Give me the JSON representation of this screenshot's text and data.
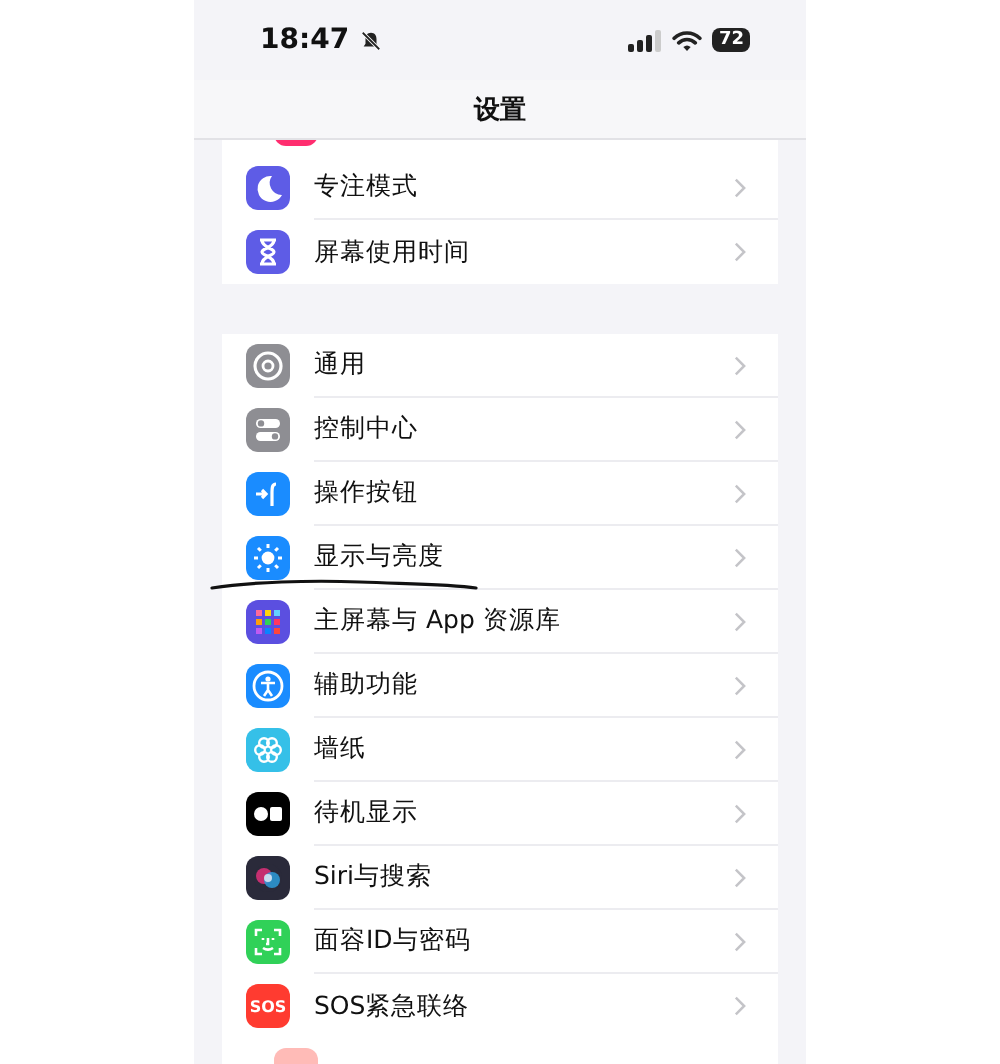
{
  "status_bar": {
    "time": "18:47",
    "silent": true,
    "battery": "72"
  },
  "title": "设置",
  "groups": [
    {
      "items": [
        {
          "label": "专注模式",
          "kind": "moon",
          "color": "#5e5ce6"
        },
        {
          "label": "屏幕使用时间",
          "kind": "hourglass",
          "color": "#5e5ce6"
        }
      ]
    },
    {
      "items": [
        {
          "label": "通用",
          "kind": "gear",
          "color": "#8e8e93"
        },
        {
          "label": "控制中心",
          "kind": "toggles",
          "color": "#8e8e93"
        },
        {
          "label": "操作按钮",
          "kind": "action",
          "color": "#1a8cff"
        },
        {
          "label": "显示与亮度",
          "kind": "sun",
          "color": "#1a8cff",
          "underlined": true
        },
        {
          "label": "主屏幕与 App 资源库",
          "kind": "grid",
          "color": "#5b4fe0"
        },
        {
          "label": "辅助功能",
          "kind": "person",
          "color": "#1a8cff"
        },
        {
          "label": "墙纸",
          "kind": "flower",
          "color": "#35c0e8"
        },
        {
          "label": "待机显示",
          "kind": "standby",
          "color": "#000000"
        },
        {
          "label": "Siri与搜索",
          "kind": "siri",
          "color": "#2a2a3a"
        },
        {
          "label": "面容ID与密码",
          "kind": "face",
          "color": "#30d158"
        },
        {
          "label": "SOS紧急联络",
          "kind": "sos",
          "color": "#ff3b30",
          "icon_text": "SOS"
        }
      ]
    }
  ]
}
